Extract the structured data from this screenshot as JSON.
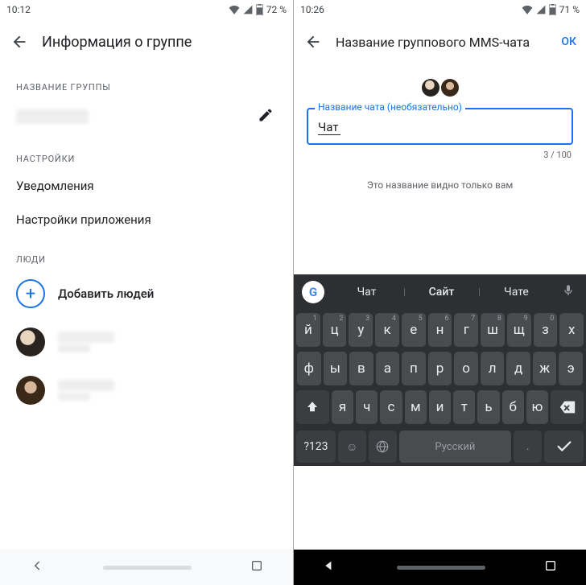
{
  "left": {
    "status": {
      "time": "10:12",
      "battery": "72 %"
    },
    "appbar": {
      "title": "Информация о группе"
    },
    "sections": {
      "group_name_label": "НАЗВАНИЕ ГРУППЫ",
      "settings_label": "НАСТРОЙКИ",
      "people_label": "ЛЮДИ"
    },
    "settings": {
      "notifications": "Уведомления",
      "app_settings": "Настройки приложения"
    },
    "people": {
      "add": "Добавить людей"
    }
  },
  "right": {
    "status": {
      "time": "10:26",
      "battery": "71 %"
    },
    "appbar": {
      "title": "Название группового MMS-чата",
      "ok": "ОК"
    },
    "field": {
      "label": "Название чата (необязательно)",
      "value": "Чат",
      "counter": "3 / 100"
    },
    "hint": "Это название видно только вам",
    "keyboard": {
      "suggestions": [
        "Чат",
        "Сайт",
        "Чате"
      ],
      "row1": [
        {
          "k": "й",
          "n": "1"
        },
        {
          "k": "ц",
          "n": "2"
        },
        {
          "k": "у",
          "n": "3"
        },
        {
          "k": "к",
          "n": "4"
        },
        {
          "k": "е",
          "n": "5"
        },
        {
          "k": "н",
          "n": "6"
        },
        {
          "k": "г",
          "n": "7"
        },
        {
          "k": "ш",
          "n": "8"
        },
        {
          "k": "щ",
          "n": "9"
        },
        {
          "k": "з",
          "n": "0"
        },
        {
          "k": "х",
          "n": ""
        }
      ],
      "row2": [
        "ф",
        "ы",
        "в",
        "а",
        "п",
        "р",
        "о",
        "л",
        "д",
        "ж",
        "э"
      ],
      "row3": [
        "я",
        "ч",
        "с",
        "м",
        "и",
        "т",
        "ь",
        "б",
        "ю"
      ],
      "sym": "?123",
      "space": "Русский"
    }
  }
}
